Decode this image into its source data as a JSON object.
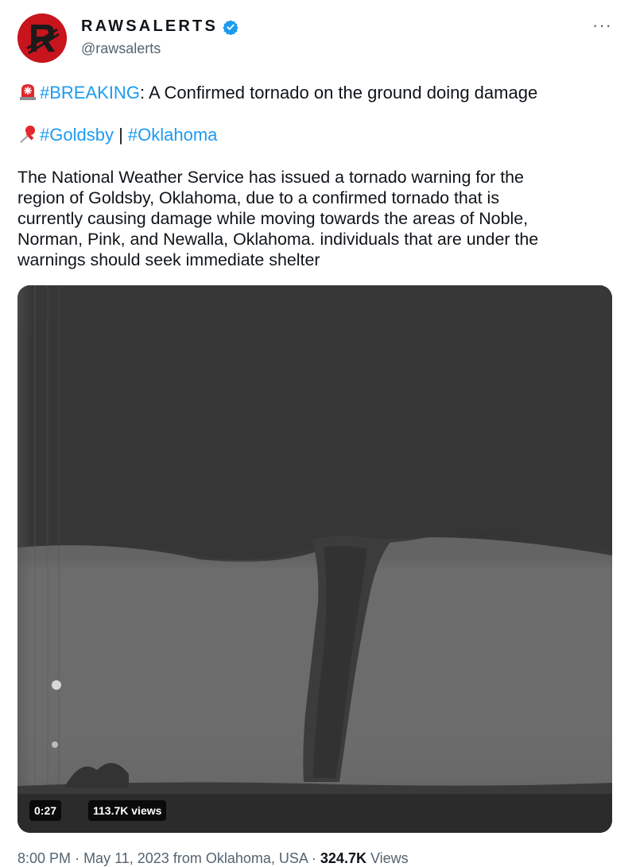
{
  "account": {
    "display_name": "RAWSALERTS",
    "handle": "@rawsalerts",
    "more_label": "···",
    "brand_color": "#c8141c",
    "verified_color": "#1d9bf0"
  },
  "tweet": {
    "line1": {
      "emoji": "rotating-light-icon",
      "hashtag": "#BREAKING",
      "text": ": A Confirmed tornado on the ground doing damage"
    },
    "line2": {
      "emoji": "pushpin-icon",
      "hashtag1": "#Goldsby",
      "separator": " | ",
      "hashtag2": "#Oklahoma"
    },
    "body_lines": [
      "The National Weather Service has issued a tornado warning for the",
      "region of Goldsby, Oklahoma, due to a confirmed tornado that is",
      "currently causing damage while moving towards the areas of Noble,",
      "Norman, Pink, and Newalla, Oklahoma. individuals that are under the",
      "warnings should seek immediate shelter"
    ]
  },
  "media": {
    "duration": "0:27",
    "views": "113.7K views"
  },
  "meta": {
    "time": "8:00 PM",
    "date": "May 11, 2023",
    "location": "from Oklahoma, USA",
    "views_count": "324.7K",
    "views_label": "Views"
  }
}
